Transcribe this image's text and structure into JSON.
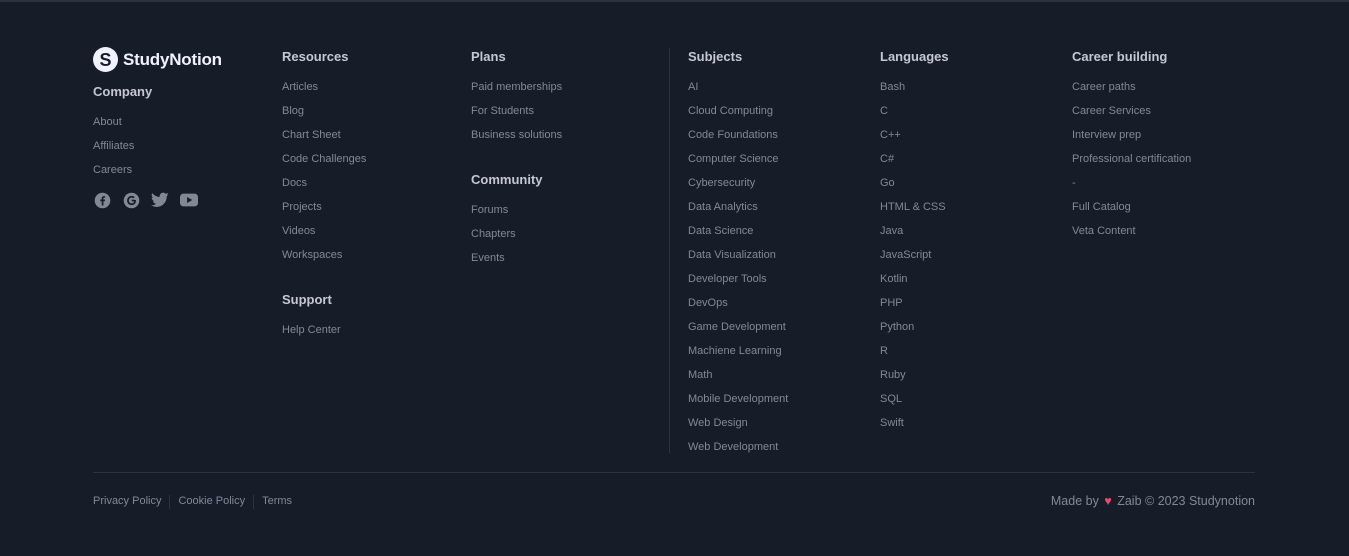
{
  "brand": {
    "mark": "S",
    "name": "StudyNotion"
  },
  "company": {
    "heading": "Company",
    "items": [
      "About",
      "Affiliates",
      "Careers"
    ]
  },
  "socials": [
    "facebook-icon",
    "google-icon",
    "twitter-icon",
    "youtube-icon"
  ],
  "resources": {
    "heading": "Resources",
    "items": [
      "Articles",
      "Blog",
      "Chart Sheet",
      "Code Challenges",
      "Docs",
      "Projects",
      "Videos",
      "Workspaces"
    ]
  },
  "support": {
    "heading": "Support",
    "items": [
      "Help Center"
    ]
  },
  "plans": {
    "heading": "Plans",
    "items": [
      "Paid memberships",
      "For Students",
      "Business solutions"
    ]
  },
  "community": {
    "heading": "Community",
    "items": [
      "Forums",
      "Chapters",
      "Events"
    ]
  },
  "subjects": {
    "heading": "Subjects",
    "items": [
      "AI",
      "Cloud Computing",
      "Code Foundations",
      "Computer Science",
      "Cybersecurity",
      "Data Analytics",
      "Data Science",
      "Data Visualization",
      "Developer Tools",
      "DevOps",
      "Game Development",
      "Machiene Learning",
      "Math",
      "Mobile Development",
      "Web Design",
      "Web Development"
    ]
  },
  "languages": {
    "heading": "Languages",
    "items": [
      "Bash",
      "C",
      "C++",
      "C#",
      "Go",
      "HTML & CSS",
      "Java",
      "JavaScript",
      "Kotlin",
      "PHP",
      "Python",
      "R",
      "Ruby",
      "SQL",
      "Swift"
    ]
  },
  "career": {
    "heading": "Career building",
    "items": [
      "Career paths",
      "Career Services",
      "Interview prep",
      "Professional certification",
      "-",
      "Full Catalog",
      "Veta Content"
    ]
  },
  "bottom": {
    "links": [
      "Privacy Policy",
      "Cookie Policy",
      "Terms"
    ],
    "made_by_prefix": "Made by",
    "heart": "♥",
    "made_by_suffix": "Zaib © 2023 Studynotion"
  },
  "colors": {
    "background": "#161d29",
    "heading": "#c5c7d4",
    "link": "#838894",
    "divider": "#2c333f",
    "heart": "#ef476f"
  }
}
